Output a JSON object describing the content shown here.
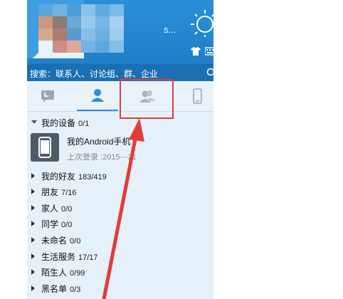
{
  "profile": {
    "nickname_tail": "s..."
  },
  "search": {
    "placeholder": "搜索：联系人、讨论组、群、企业"
  },
  "tabs": [
    {
      "name": "recent-chats",
      "icon": "chat-bubble-icon"
    },
    {
      "name": "contacts",
      "icon": "person-icon",
      "active": true
    },
    {
      "name": "groups",
      "icon": "group-icon"
    },
    {
      "name": "devices",
      "icon": "phone-icon"
    }
  ],
  "groups": [
    {
      "label": "我的设备",
      "count": "0/1",
      "expanded": true
    },
    {
      "label": "我的好友",
      "count": "183/419"
    },
    {
      "label": "朋友",
      "count": "7/16"
    },
    {
      "label": "家人",
      "count": "0/0"
    },
    {
      "label": "同学",
      "count": "0/0"
    },
    {
      "label": "未命名",
      "count": "0/0"
    },
    {
      "label": "生活服务",
      "count": "17/17"
    },
    {
      "label": "陌生人",
      "count": "0/99"
    },
    {
      "label": "黑名单",
      "count": "0/3"
    }
  ],
  "device": {
    "name": "我的Android手机",
    "status": "上次登录 :2015-·-21"
  },
  "colors": {
    "header": "#2b8fd7",
    "search_bar": "#1a6fb3",
    "list_bg": "#e6f0f8",
    "annotation_red": "#e23b3b"
  }
}
